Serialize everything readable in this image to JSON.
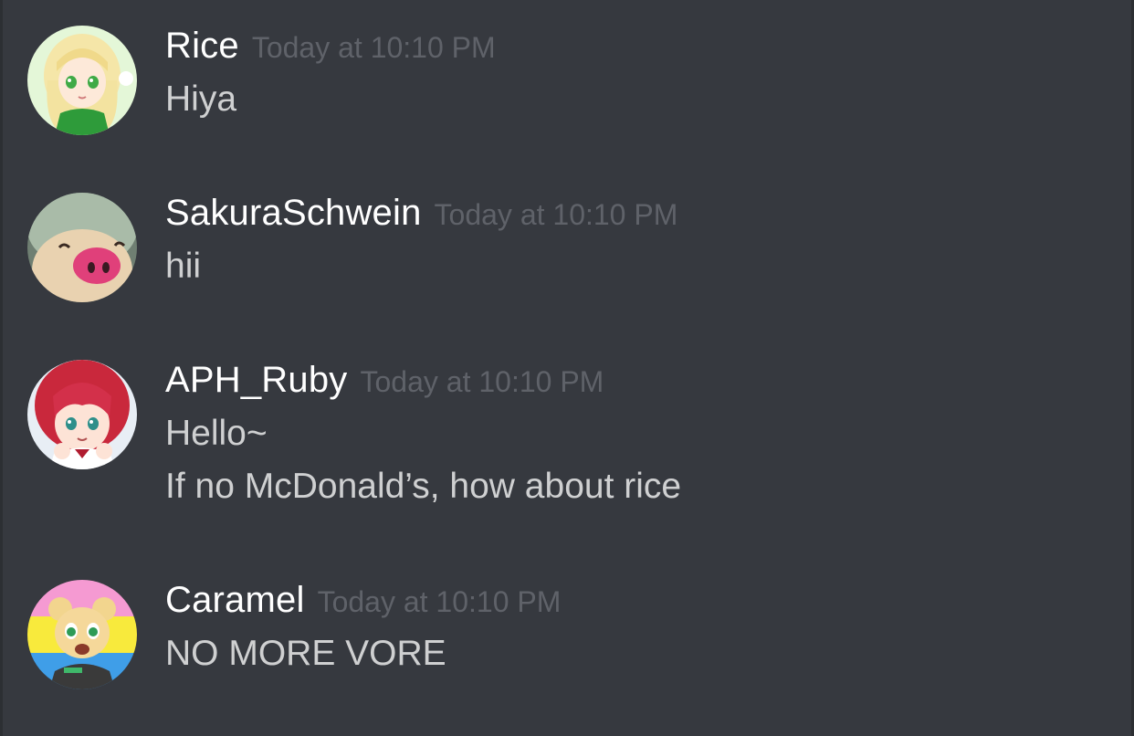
{
  "messages": [
    {
      "username": "Rice",
      "timestamp": "Today at 10:10 PM",
      "avatar_icon": "anime-girl-green-hoodie-avatar",
      "lines": [
        "Hiya"
      ]
    },
    {
      "username": "SakuraSchwein",
      "timestamp": "Today at 10:10 PM",
      "avatar_icon": "pig-plush-avatar",
      "lines": [
        "hii"
      ]
    },
    {
      "username": "APH_Ruby",
      "timestamp": "Today at 10:10 PM",
      "avatar_icon": "red-hair-anime-girl-avatar",
      "lines": [
        "Hello~",
        "If no McDonald’s, how about rice"
      ]
    },
    {
      "username": "Caramel",
      "timestamp": "Today at 10:10 PM",
      "avatar_icon": "cartoon-mouse-avatar",
      "lines": [
        "NO MORE VORE"
      ]
    }
  ],
  "colors": {
    "background": "#36393f",
    "username": "#ffffff",
    "timestamp": "#5f6269",
    "message_text": "#dcddde"
  }
}
